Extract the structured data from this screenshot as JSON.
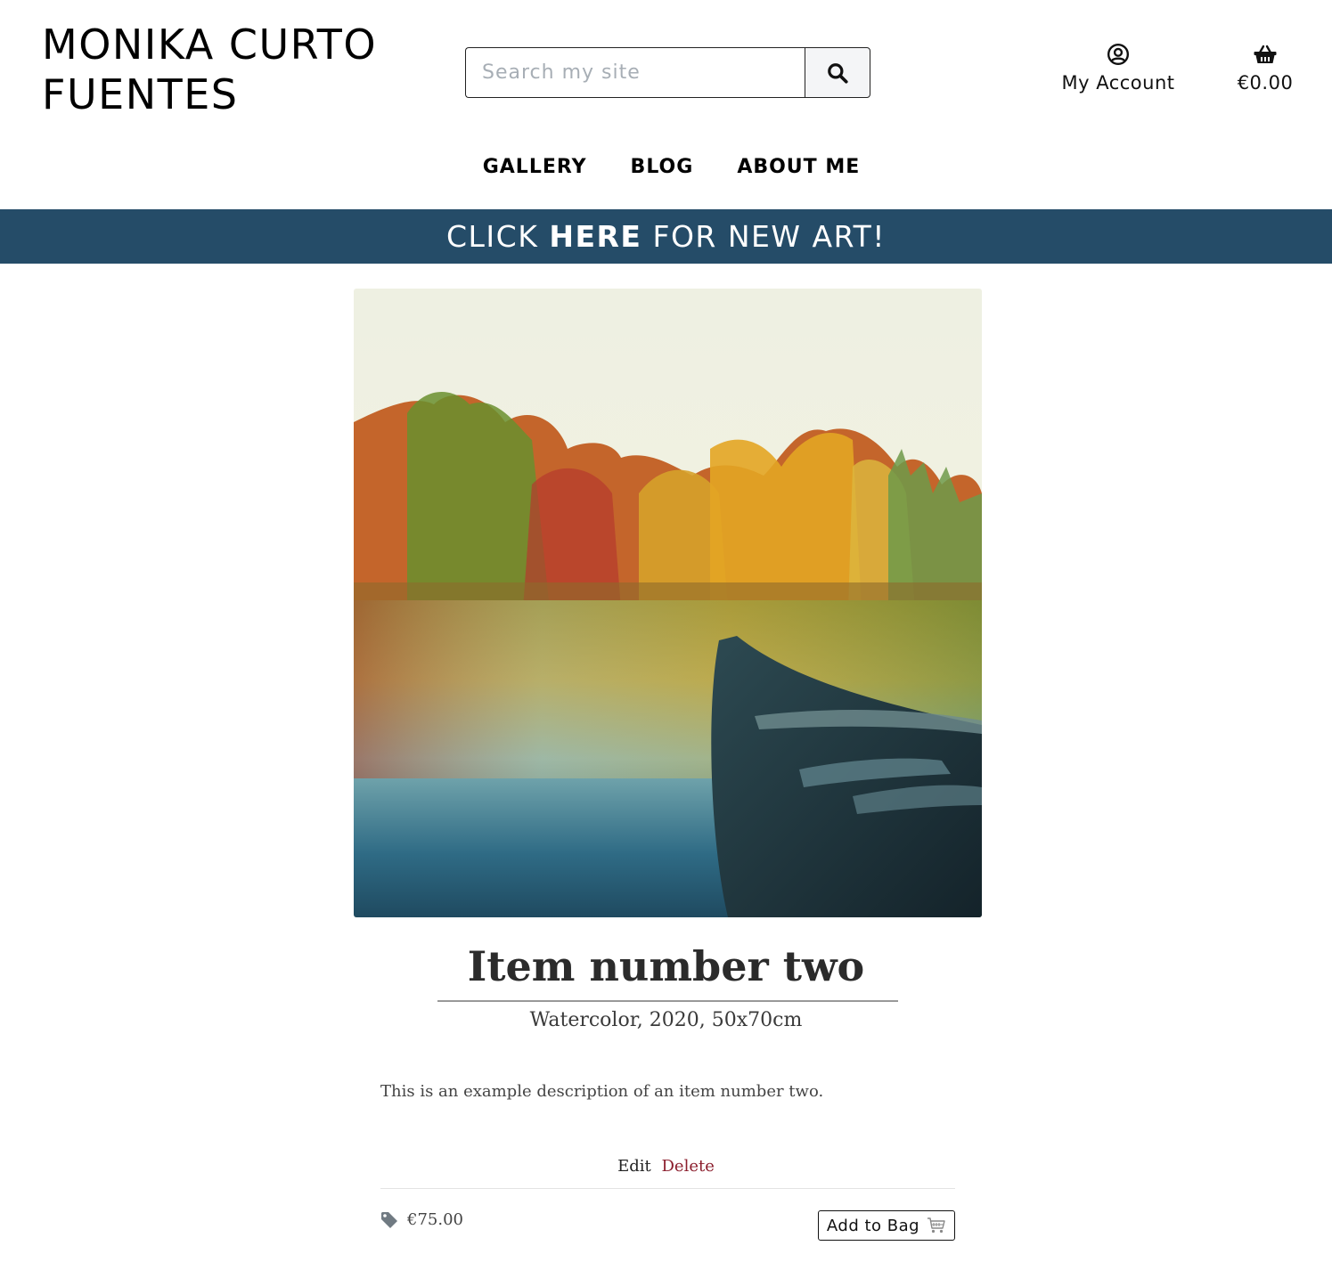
{
  "header": {
    "brand": "MONIKA CURTO FUENTES",
    "search": {
      "placeholder": "Search my site",
      "button_icon": "search-icon"
    },
    "account": {
      "label": "My Account",
      "icon": "user-circle-icon"
    },
    "bag": {
      "total": "€0.00",
      "icon": "shopping-basket-icon"
    }
  },
  "nav": {
    "items": [
      {
        "label": "GALLERY"
      },
      {
        "label": "BLOG"
      },
      {
        "label": "ABOUT ME"
      }
    ]
  },
  "banner": {
    "part1": "CLICK ",
    "part2": "HERE",
    "part3": " FOR NEW ART!",
    "background": "#254c68"
  },
  "product": {
    "title": "Item number two",
    "subtitle": "Watercolor, 2020, 50x70cm",
    "description": "This is an example description of an item number two.",
    "admin": {
      "edit_label": "Edit",
      "delete_label": "Delete"
    },
    "price": "€75.00",
    "price_icon": "price-tag-icon",
    "add_to_bag_label": "Add to Bag",
    "add_to_bag_icon": "cart-icon"
  },
  "colors": {
    "banner": "#254c68",
    "delete_link": "#8b1d2c"
  }
}
